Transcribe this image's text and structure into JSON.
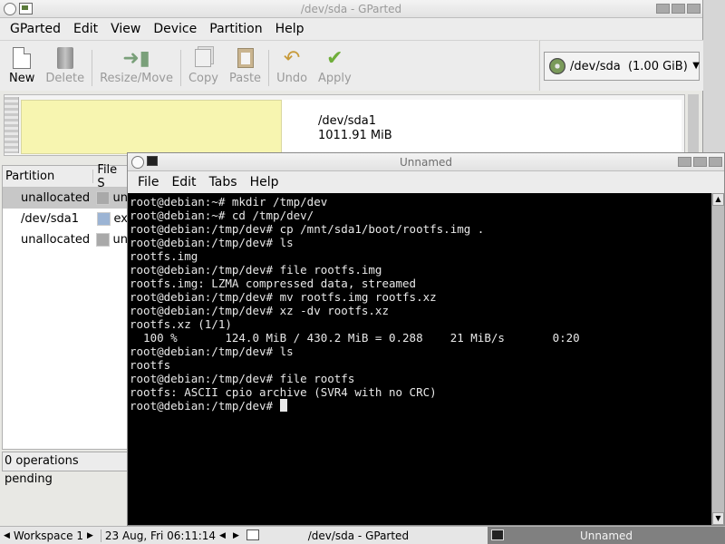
{
  "gparted": {
    "title": "/dev/sda - GParted",
    "menu": [
      "GParted",
      "Edit",
      "View",
      "Device",
      "Partition",
      "Help"
    ],
    "toolbar": {
      "new": "New",
      "delete": "Delete",
      "resize_move": "Resize/Move",
      "copy": "Copy",
      "paste": "Paste",
      "undo": "Undo",
      "apply": "Apply"
    },
    "device_selector": "/dev/sda  (1.00 GiB)",
    "disk_map": {
      "partition_name": "/dev/sda1",
      "partition_size": "1011.91 MiB"
    },
    "partition_list": {
      "columns": [
        "Partition",
        "File S"
      ],
      "rows": [
        {
          "name": "unallocated",
          "fs": "un",
          "swatch": "#a9a9a9",
          "selected": true
        },
        {
          "name": "/dev/sda1",
          "fs": "ex",
          "swatch": "#9cb4d4",
          "selected": false
        },
        {
          "name": "unallocated",
          "fs": "un",
          "swatch": "#a9a9a9",
          "selected": false
        }
      ]
    },
    "status": "0 operations pending"
  },
  "terminal": {
    "title": "Unnamed",
    "menu": [
      "File",
      "Edit",
      "Tabs",
      "Help"
    ],
    "lines": [
      "root@debian:~# mkdir /tmp/dev",
      "root@debian:~# cd /tmp/dev/",
      "root@debian:/tmp/dev# cp /mnt/sda1/boot/rootfs.img .",
      "root@debian:/tmp/dev# ls",
      "rootfs.img",
      "root@debian:/tmp/dev# file rootfs.img",
      "rootfs.img: LZMA compressed data, streamed",
      "root@debian:/tmp/dev# mv rootfs.img rootfs.xz",
      "root@debian:/tmp/dev# xz -dv rootfs.xz",
      "rootfs.xz (1/1)",
      "  100 %       124.0 MiB / 430.2 MiB = 0.288    21 MiB/s       0:20",
      "root@debian:/tmp/dev# ls",
      "rootfs",
      "root@debian:/tmp/dev# file rootfs",
      "rootfs: ASCII cpio archive (SVR4 with no CRC)"
    ],
    "prompt": "root@debian:/tmp/dev# "
  },
  "taskbar": {
    "workspace": "Workspace 1",
    "datetime": "23 Aug, Fri 06:11:14",
    "tasks": [
      "/dev/sda - GParted",
      "Unnamed"
    ]
  }
}
